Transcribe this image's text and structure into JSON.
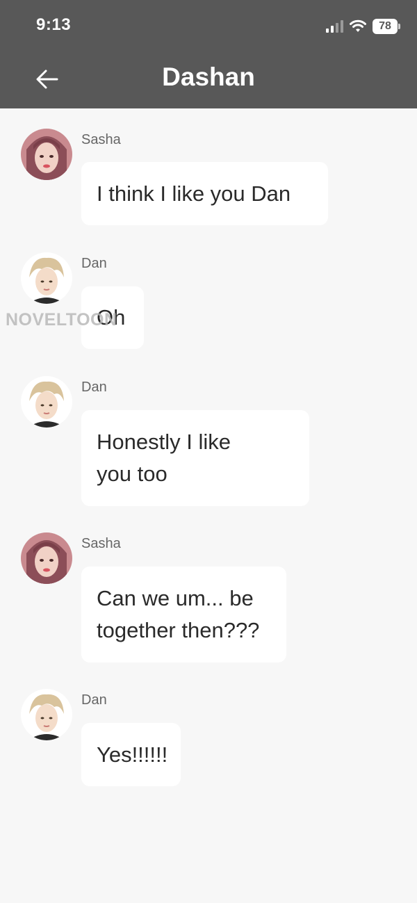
{
  "status_bar": {
    "time": "9:13",
    "battery": "78"
  },
  "header": {
    "title": "Dashan"
  },
  "watermark": "NOVELTOON",
  "messages": [
    {
      "sender": "Sasha",
      "text": "I think I like you Dan",
      "avatar": "sasha-avatar"
    },
    {
      "sender": "Dan",
      "text": "Oh",
      "avatar": "dan-avatar"
    },
    {
      "sender": "Dan",
      "text": "Honestly I like you too",
      "avatar": "dan-avatar"
    },
    {
      "sender": "Sasha",
      "text": "Can we um... be together then???",
      "avatar": "sasha-avatar"
    },
    {
      "sender": "Dan",
      "text": "Yes!!!!!!",
      "avatar": "dan-avatar"
    }
  ],
  "colors": {
    "header_bg": "#585858",
    "page_bg": "#f7f7f7",
    "bubble_bg": "#ffffff"
  }
}
